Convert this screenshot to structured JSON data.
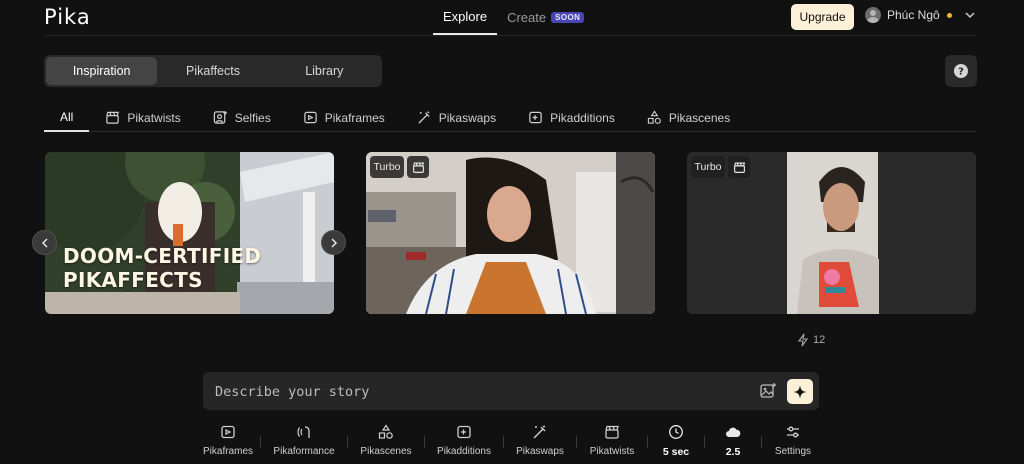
{
  "app": {
    "logo": "Pika"
  },
  "topnav": {
    "explore": "Explore",
    "create": "Create",
    "create_badge": "SOON"
  },
  "account": {
    "upgrade_label": "Upgrade",
    "user_name": "Phúc Ngô",
    "status_color": "#f2b72c"
  },
  "segments": [
    "Inspiration",
    "Pikaffects",
    "Library"
  ],
  "help_label": "?",
  "filters": [
    {
      "label": "All",
      "icon": "none"
    },
    {
      "label": "Pikatwists",
      "icon": "clapper-icon"
    },
    {
      "label": "Selfies",
      "icon": "selfie-icon"
    },
    {
      "label": "Pikaframes",
      "icon": "frames-icon"
    },
    {
      "label": "Pikaswaps",
      "icon": "wand-icon"
    },
    {
      "label": "Pikadditions",
      "icon": "add-frame-icon"
    },
    {
      "label": "Pikascenes",
      "icon": "shapes-icon"
    }
  ],
  "cards": [
    {
      "headline_line1": "DOOM-CERTIFIED",
      "headline_line2": "PIKAFFECTS"
    },
    {
      "badge": "Turbo"
    },
    {
      "badge": "Turbo"
    }
  ],
  "likes": {
    "count": "12"
  },
  "prompt": {
    "placeholder": "Describe your story"
  },
  "toolbar": [
    {
      "label": "Pikaframes",
      "icon": "frames-icon"
    },
    {
      "label": "Pikaformance",
      "icon": "pikaformance-icon"
    },
    {
      "label": "Pikascenes",
      "icon": "shapes-icon"
    },
    {
      "label": "Pikadditions",
      "icon": "add-frame-icon"
    },
    {
      "label": "Pikaswaps",
      "icon": "wand-icon"
    },
    {
      "label": "Pikatwists",
      "icon": "clapper-icon"
    },
    {
      "label": "5 sec",
      "icon": "clock-icon"
    },
    {
      "label": "2.5",
      "icon": "cloud-icon"
    },
    {
      "label": "Settings",
      "icon": "sliders-icon"
    }
  ],
  "colors": {
    "accent": "#fdf0d9",
    "soon_badge": "#4a45b5",
    "background": "#111111"
  }
}
